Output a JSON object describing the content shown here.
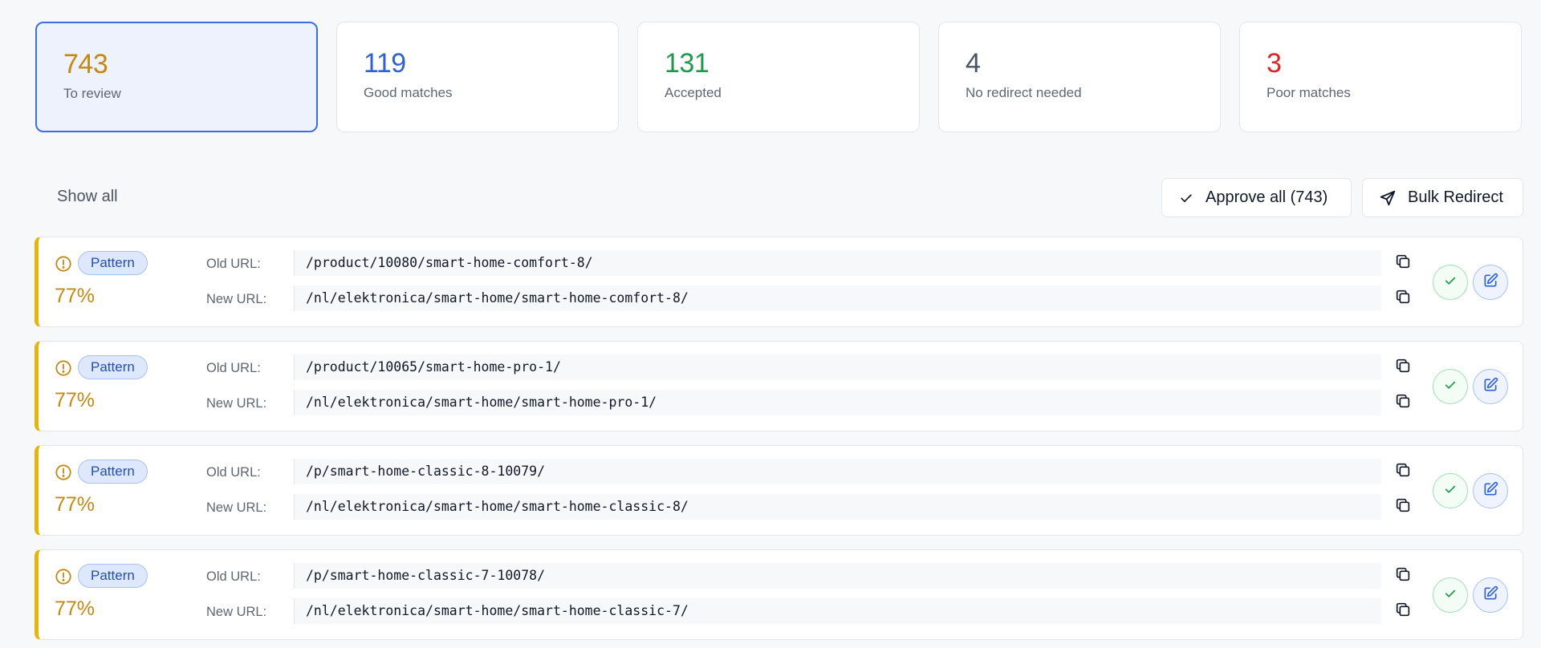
{
  "stats": [
    {
      "value": "743",
      "label": "To review",
      "color": "#c58911",
      "active": true
    },
    {
      "value": "119",
      "label": "Good matches",
      "color": "#2f62d9",
      "active": false
    },
    {
      "value": "131",
      "label": "Accepted",
      "color": "#1f9a4a",
      "active": false
    },
    {
      "value": "4",
      "label": "No redirect needed",
      "color": "#4b5563",
      "active": false
    },
    {
      "value": "3",
      "label": "Poor matches",
      "color": "#dc2626",
      "active": false
    }
  ],
  "toolbar": {
    "show_all": "Show all",
    "approve_all": "Approve all (743)",
    "bulk_redirect": "Bulk Redirect"
  },
  "labels": {
    "old_url": "Old URL:",
    "new_url": "New URL:"
  },
  "rows": [
    {
      "badge": "Pattern",
      "score": "77%",
      "old_url": "/product/10080/smart-home-comfort-8/",
      "new_url": "/nl/elektronica/smart-home/smart-home-comfort-8/"
    },
    {
      "badge": "Pattern",
      "score": "77%",
      "old_url": "/product/10065/smart-home-pro-1/",
      "new_url": "/nl/elektronica/smart-home/smart-home-pro-1/"
    },
    {
      "badge": "Pattern",
      "score": "77%",
      "old_url": "/p/smart-home-classic-8-10079/",
      "new_url": "/nl/elektronica/smart-home/smart-home-classic-8/"
    },
    {
      "badge": "Pattern",
      "score": "77%",
      "old_url": "/p/smart-home-classic-7-10078/",
      "new_url": "/nl/elektronica/smart-home/smart-home-classic-7/"
    }
  ],
  "icons": {
    "warning": "alert-circle-icon",
    "copy": "copy-icon",
    "accept": "check-icon",
    "edit": "edit-icon",
    "approve": "check-icon",
    "bulk": "send-icon"
  },
  "colors": {
    "accent": "#3b6fe0",
    "row_accent": "#eab308",
    "score": "#c58911",
    "badge_bg": "#dde8fc",
    "accept": "#22a04f",
    "edit": "#2f62d9"
  }
}
